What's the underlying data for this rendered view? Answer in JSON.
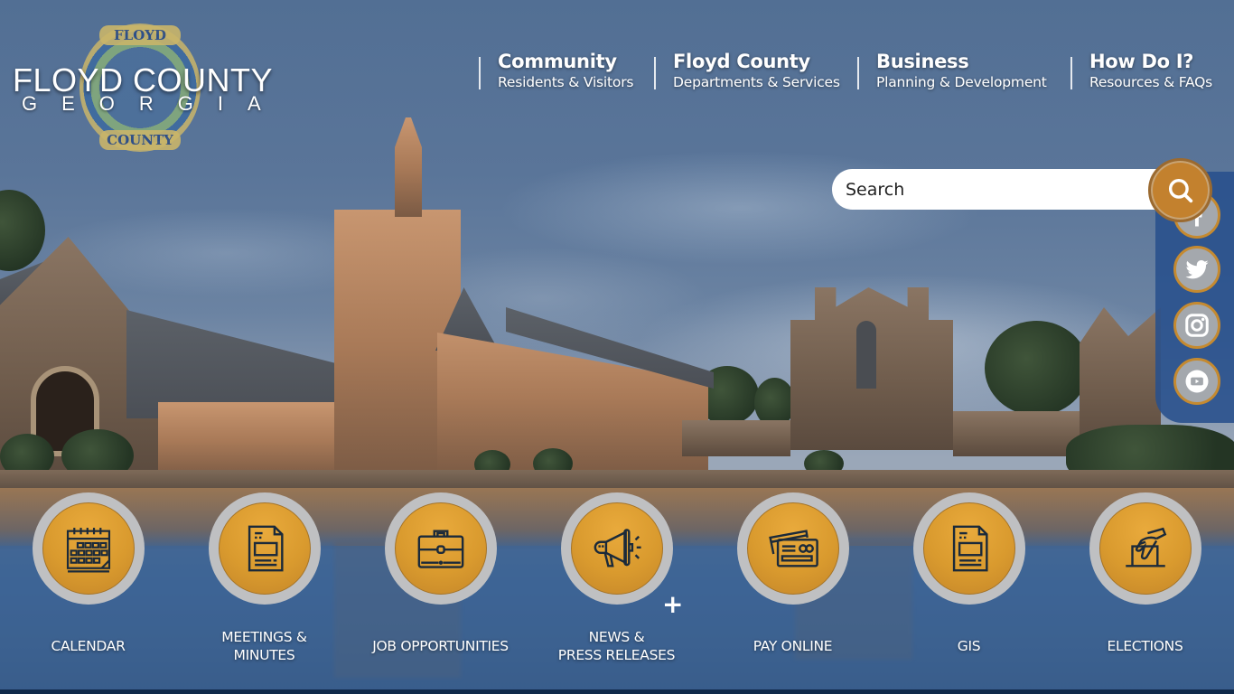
{
  "logo": {
    "title": "FLOYD COUNTY",
    "subtitle": "GEORGIA",
    "seal_top": "FLOYD",
    "seal_bottom": "COUNTY"
  },
  "nav": [
    {
      "title": "Community",
      "subtitle": "Residents & Visitors"
    },
    {
      "title": "Floyd County",
      "subtitle": "Departments & Services"
    },
    {
      "title": "Business",
      "subtitle": "Planning & Development"
    },
    {
      "title": "How Do I?",
      "subtitle": "Resources & FAQs"
    }
  ],
  "search": {
    "placeholder": "Search",
    "value": ""
  },
  "social": [
    {
      "name": "facebook",
      "icon": "facebook-icon"
    },
    {
      "name": "twitter",
      "icon": "twitter-icon"
    },
    {
      "name": "instagram",
      "icon": "instagram-icon"
    },
    {
      "name": "youtube",
      "icon": "youtube-icon"
    }
  ],
  "quick_links": [
    {
      "label": "CALENDAR",
      "icon": "calendar-icon"
    },
    {
      "label": "MEETINGS & MINUTES",
      "icon": "document-icon"
    },
    {
      "label": "JOB OPPORTUNITIES",
      "icon": "briefcase-icon"
    },
    {
      "label": "NEWS & PRESS RELEASES",
      "icon": "megaphone-icon"
    },
    {
      "label": "PAY ONLINE",
      "icon": "credit-card-icon"
    },
    {
      "label": "GIS",
      "icon": "document-icon"
    },
    {
      "label": "ELECTIONS",
      "icon": "ballot-box-icon"
    }
  ],
  "more_toggle": "+",
  "colors": {
    "accent_gold": "#d99a2e",
    "sidebar_blue": "#28508c",
    "circle_gray": "#bfc0c2",
    "footer_navy": "#102a4a"
  }
}
